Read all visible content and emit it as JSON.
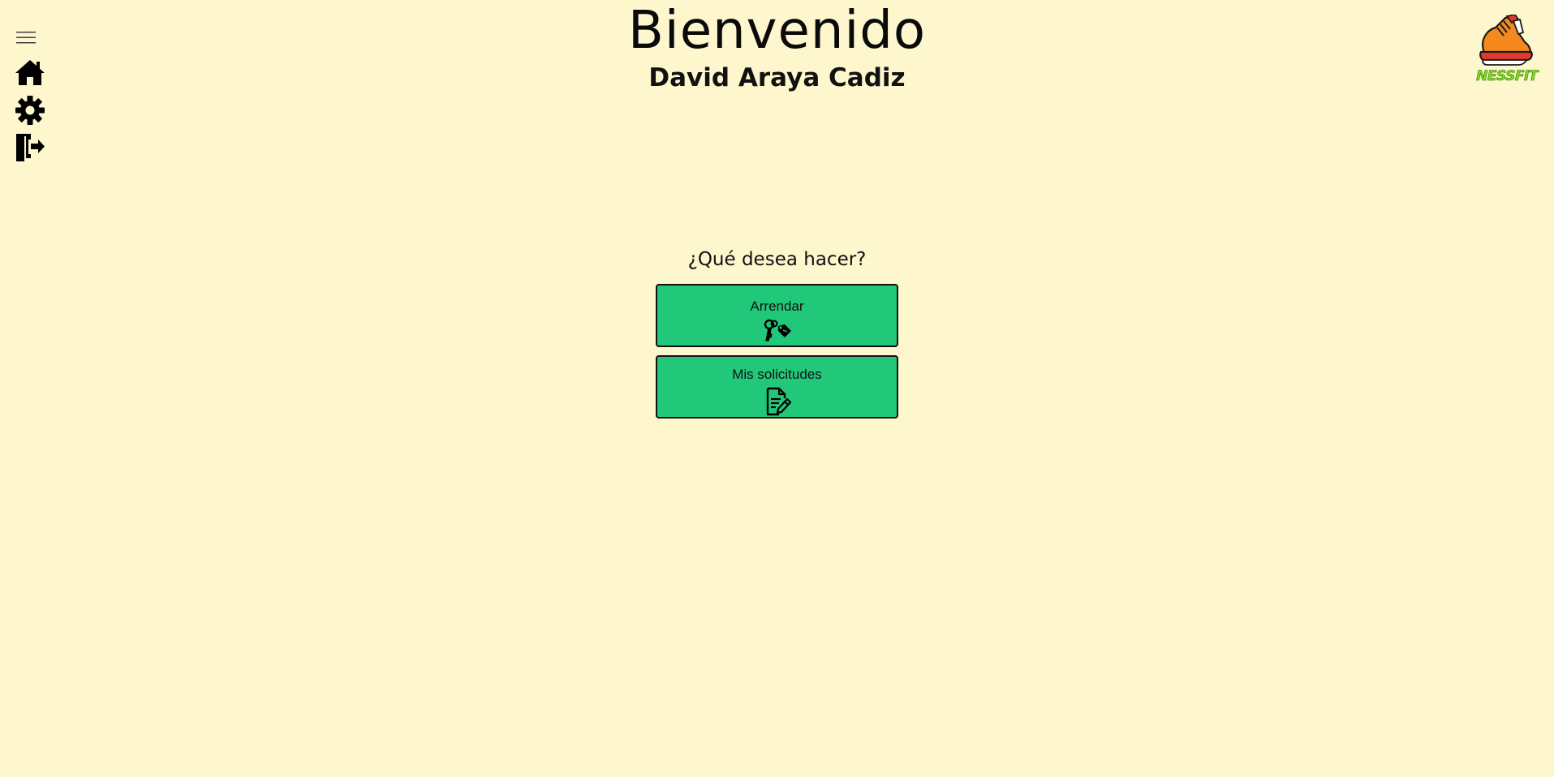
{
  "header": {
    "title": "Bienvenido",
    "user_name": "David Araya Cadiz"
  },
  "sidebar": {
    "items": [
      {
        "name": "menu",
        "icon": "hamburger-menu-icon"
      },
      {
        "name": "home",
        "icon": "home-icon"
      },
      {
        "name": "settings",
        "icon": "gear-icon"
      },
      {
        "name": "logout",
        "icon": "logout-door-icon"
      }
    ]
  },
  "logo": {
    "text": "NESSFIT",
    "icon": "sneaker-logo-icon"
  },
  "main": {
    "question": "¿Qué desea hacer?",
    "actions": [
      {
        "label": "Arrendar",
        "icon": "keys-tag-icon"
      },
      {
        "label": "Mis solicitudes",
        "icon": "document-edit-icon"
      }
    ]
  },
  "colors": {
    "background": "#FEF6CD",
    "button": "#22C87A",
    "logo_text": "#7EE21F"
  }
}
